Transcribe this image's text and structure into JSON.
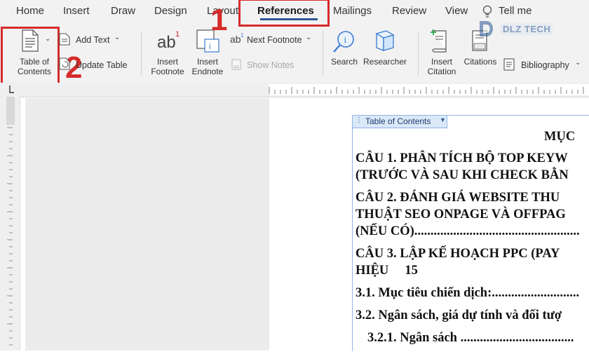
{
  "tabs": [
    "Home",
    "Insert",
    "Draw",
    "Design",
    "Layout",
    "References",
    "Mailings",
    "Review",
    "View",
    "Tell me"
  ],
  "active_tab": "References",
  "watermark": "DLZ TECH",
  "annotations": {
    "step1": "1",
    "step2": "2"
  },
  "ribbon": {
    "toc_button": "Table of Contents",
    "toc_line1": "Table of",
    "toc_line2": "Contents",
    "add_text": "Add Text",
    "update_table": "Update Table",
    "insert_footnote_1": "Insert",
    "insert_footnote_2": "Footnote",
    "insert_endnote_1": "Insert",
    "insert_endnote_2": "Endnote",
    "next_footnote": "Next Footnote",
    "show_notes": "Show Notes",
    "search": "Search",
    "researcher": "Researcher",
    "insert_citation_1": "Insert",
    "insert_citation_2": "Citation",
    "citations": "Citations",
    "bibliography": "Bibliography"
  },
  "document": {
    "toc_handle_label": "Table of Contents",
    "heading": "MỤC",
    "lines": [
      "CÂU 1.  PHÂN TÍCH BỘ TOP KEYW",
      "(TRƯỚC VÀ SAU KHI CHECK BẰN",
      "CÂU 2.  ĐÁNH GIÁ WEBSITE THU",
      "THUẬT SEO ONPAGE VÀ OFFPAG",
      "(NẾU CÓ)...................................................",
      "CÂU 3.  LẬP KẾ HOẠCH PPC (PAY",
      "HIỆU     15",
      "3.1. Mục tiêu chiến dịch:...........................",
      "3.2. Ngân sách, giá dự tính và đối tượ",
      "3.2.1. Ngân sách ..................................."
    ]
  },
  "colors": {
    "accent": "#2b5797",
    "annotation_red": "#d62a2a",
    "toc_border": "#8fb5e8"
  }
}
